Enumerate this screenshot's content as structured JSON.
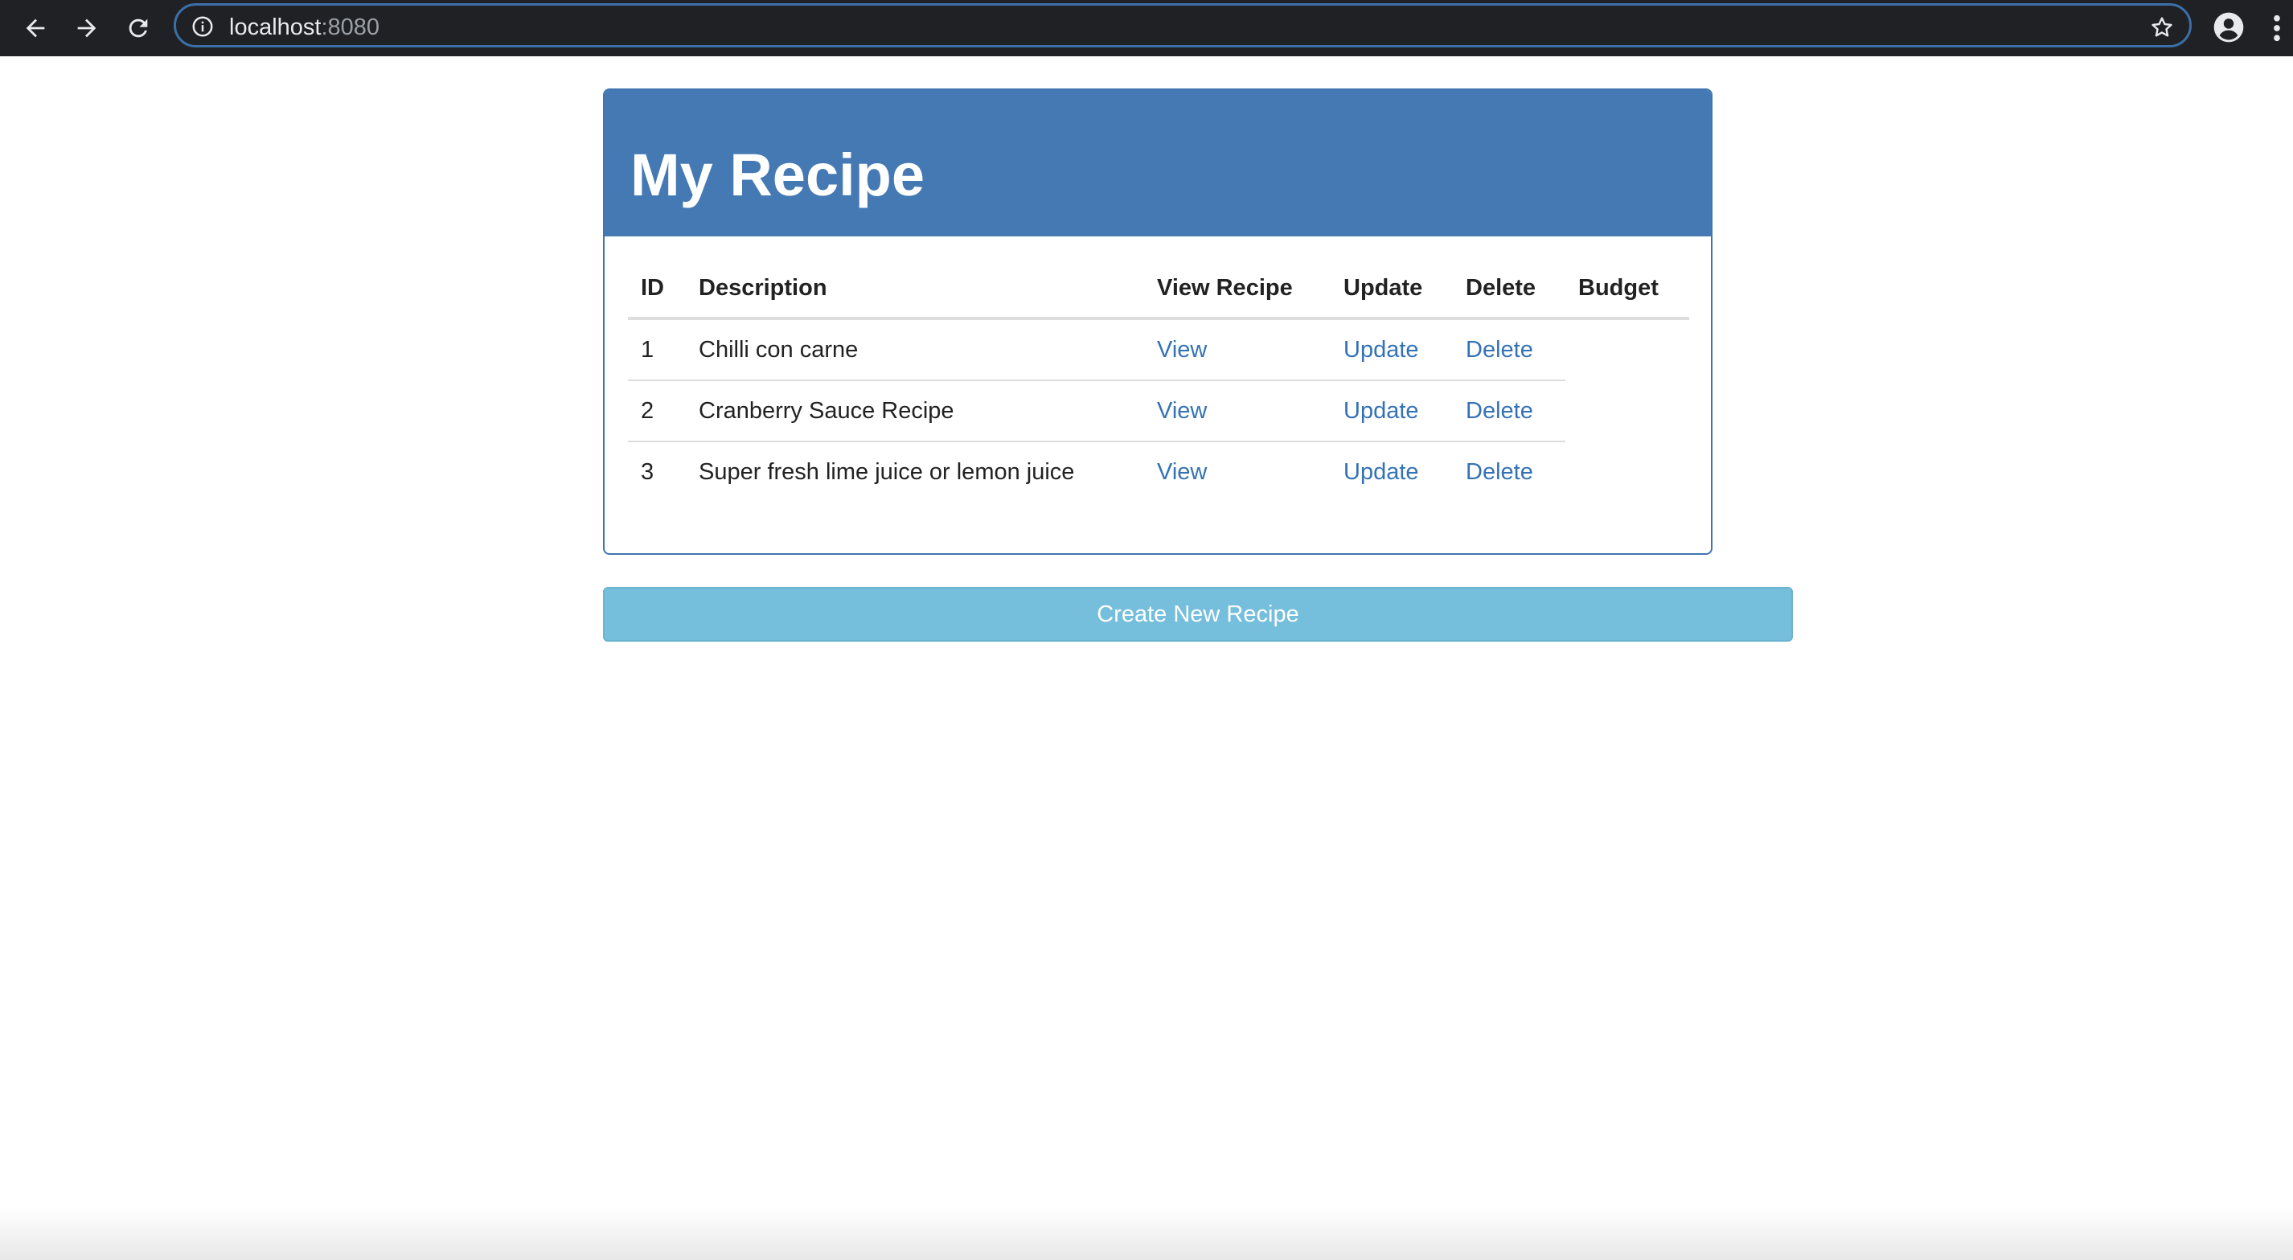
{
  "browser": {
    "url_host": "localhost",
    "url_port": ":8080",
    "icons": [
      "back-arrow-icon",
      "forward-arrow-icon",
      "reload-icon",
      "site-info-icon",
      "bookmark-star-icon",
      "profile-icon",
      "menu-dots-icon"
    ]
  },
  "page": {
    "title": "My Recipe",
    "table": {
      "headers": [
        "ID",
        "Description",
        "View Recipe",
        "Update",
        "Delete",
        "Budget"
      ],
      "rows": [
        {
          "id": "1",
          "description": "Chilli con carne",
          "view": "View",
          "update": "Update",
          "delete": "Delete"
        },
        {
          "id": "2",
          "description": "Cranberry Sauce Recipe",
          "view": "View",
          "update": "Update",
          "delete": "Delete"
        },
        {
          "id": "3",
          "description": "Super fresh lime juice or lemon juice",
          "view": "View",
          "update": "Update",
          "delete": "Delete"
        }
      ]
    },
    "create_button": "Create New Recipe"
  },
  "colors": {
    "heading_bg": "#4479b3",
    "link": "#3472b5",
    "button_bg": "#76bfdc",
    "browser_bar": "#202124"
  }
}
